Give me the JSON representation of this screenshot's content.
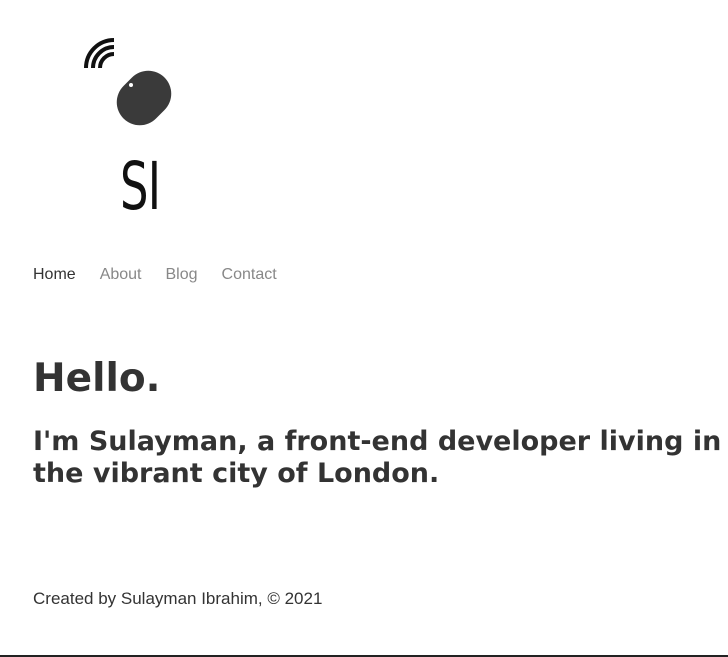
{
  "logo": {
    "icon": "wireless-mouse-icon",
    "text": "SI"
  },
  "nav": {
    "items": [
      {
        "label": "Home",
        "active": true
      },
      {
        "label": "About",
        "active": false
      },
      {
        "label": "Blog",
        "active": false
      },
      {
        "label": "Contact",
        "active": false
      }
    ]
  },
  "hero": {
    "title": "Hello.",
    "subtitle": "I'm Sulayman, a front-end developer living in the vibrant city of London."
  },
  "footer": {
    "text": "Created by Sulayman Ibrahim, © 2021"
  },
  "colors": {
    "text": "#333333",
    "nav_inactive": "#888888",
    "icon": "#3a3a3a"
  }
}
